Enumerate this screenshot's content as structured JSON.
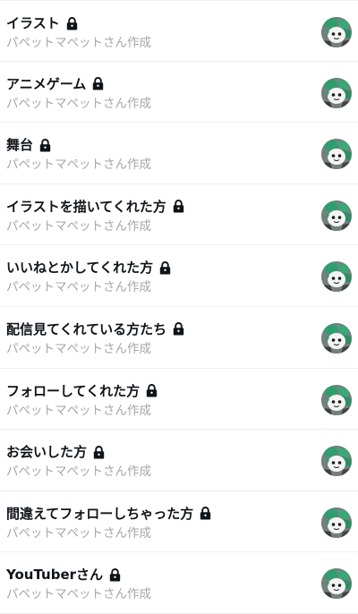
{
  "lists": [
    {
      "title": "イラスト",
      "creator": "パペットマペットさん作成"
    },
    {
      "title": "アニメゲーム",
      "creator": "パペットマペットさん作成"
    },
    {
      "title": "舞台",
      "creator": "パペットマペットさん作成"
    },
    {
      "title": "イラストを描いてくれた方",
      "creator": "パペットマペットさん作成"
    },
    {
      "title": "いいねとかしてくれた方",
      "creator": "パペットマペットさん作成"
    },
    {
      "title": "配信見てくれている方たち",
      "creator": "パペットマペットさん作成"
    },
    {
      "title": "フォローしてくれた方",
      "creator": "パペットマペットさん作成"
    },
    {
      "title": "お会いした方",
      "creator": "パペットマペットさん作成"
    },
    {
      "title": "間違えてフォローしちゃった方",
      "creator": "パペットマペットさん作成"
    },
    {
      "title": "YouTuberさん",
      "creator": "パペットマペットさん作成"
    }
  ],
  "icons": {
    "lock": "lock-icon",
    "avatar": "creator-avatar"
  },
  "colors": {
    "title": "#0f1419",
    "subtitle": "#a6a6a6",
    "divider": "#eeeeee",
    "avatar_green": "#2e9e6e"
  }
}
